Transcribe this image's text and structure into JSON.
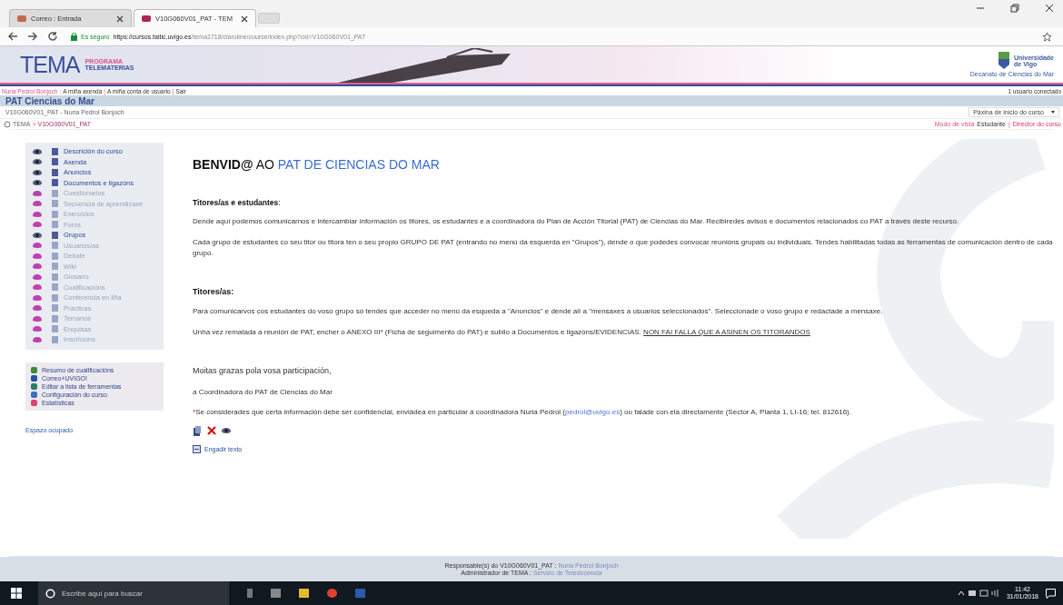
{
  "browser": {
    "tabs": [
      {
        "label": "Correo : Entrada",
        "selected": false
      },
      {
        "label": "V10G060V01_PAT - TEM",
        "selected": true
      }
    ],
    "security": "Es seguro",
    "url_host": "https://cursos.faitic.uvigo.es",
    "url_path": "/tema1718/claroline/course/index.php?cid=V10G060V01_PAT"
  },
  "banner": {
    "logo": "TEMA",
    "logo_sub1": "PROGRAMA",
    "logo_sub2": "TELEMATERIAS",
    "university1": "Universidade",
    "university2": "de Vigo",
    "faculty": "Decanato de Ciencias do Mar"
  },
  "user_bar": {
    "user": "Nuria Pedrol Bonjoch",
    "user_separator": ":",
    "link_separator": "|",
    "links": [
      "A miña axenda",
      "A miña conta de usuario",
      "Sair"
    ],
    "online": "1 usuario conectado"
  },
  "course": {
    "title": "PAT Ciencias do Mar",
    "subtitle": "V10G060V01_PAT - Nuria Pedrol Bonjoch",
    "home_select": "Páxina de inicio do curso"
  },
  "breadcrumb": {
    "root": "TEMA",
    "separator": ">",
    "view_separator": "|",
    "current": "V10G060V01_PAT",
    "view_label": "Modo de vista",
    "view_modes": [
      {
        "label": "Estudante",
        "selected": true
      },
      {
        "label": "Director do curso",
        "selected": false
      }
    ]
  },
  "tools": [
    {
      "label": "Descrición do curso",
      "visible": true
    },
    {
      "label": "Axenda",
      "visible": true
    },
    {
      "label": "Anuncios",
      "visible": true
    },
    {
      "label": "Documentos e ligazóns",
      "visible": true
    },
    {
      "label": "Cuestionarios",
      "visible": false
    },
    {
      "label": "Secuencia de aprendizaxe",
      "visible": false
    },
    {
      "label": "Exercicios",
      "visible": false
    },
    {
      "label": "Foros",
      "visible": false
    },
    {
      "label": "Grupos",
      "visible": true
    },
    {
      "label": "Usuarios/as",
      "visible": false
    },
    {
      "label": "Debate",
      "visible": false
    },
    {
      "label": "Wiki",
      "visible": false
    },
    {
      "label": "Glosario",
      "visible": false
    },
    {
      "label": "Cualificacións",
      "visible": false
    },
    {
      "label": "Conferencia en liña",
      "visible": false
    },
    {
      "label": "Prácticas",
      "visible": false
    },
    {
      "label": "Temarios",
      "visible": false
    },
    {
      "label": "Enquisas",
      "visible": false
    },
    {
      "label": "Inscricións",
      "visible": false
    }
  ],
  "admin_links": [
    "Resumo de cualificacións",
    "Correo+UVIGO!",
    "Editar a lista de ferramentas",
    "Configuración do curso",
    "Estatísticas"
  ],
  "disk_space": "Espazo ocupado",
  "content": {
    "heading_bold": "BENVID@",
    "heading_ao": "AO",
    "heading_link": "PAT DE CIENCIAS DO MAR",
    "section1": "Titores/as e estudantes",
    "section1_colon": ":",
    "p1": "Dende aquí podemos comunicarnos e intercambiar información os titores, os estudantes e a coordinadora do Plan de Acción Titorial (PAT) de Ciencias do Mar. Recibiredes avisos e documentos relacionados co PAT a través deste recurso.",
    "p2": "Cada grupo de estudantes co seu titor ou titora ten o seu propio GRUPO DE PAT (entrando no menú da esquerda en \"Grupos\"), dende o que podedes convocar reunións grupais ou individuais. Tendes habilitadas todas as ferramentas de comunicación dentro de cada grupo.",
    "section2": "Titores/as:",
    "p3": "Para comunicarvos cos estudantes do voso grupo só tendes que acceder no menú da esqueda a \"Anuncios\" e dende alí a \"mensaxes a usuarios seleccionados\". Seleccionade o voso grupo e redactade a mensaxe.",
    "p4": "Unha vez rematada a reunión de PAT, encher o ANEXO III* (Ficha de seguimento do PAT) e subilo a Documentos e ligazóns/EVIDENCIAS.",
    "p4_underlined": "NON FAI FALLA QUE A ASINEN OS TITORANDOS",
    "thanks": "Moitas grazas pola vosa participación,",
    "signature": "a Coordinadora do PAT de Ciencias do Mar",
    "note_star": "*",
    "note": "Se considerades que certa información debe ser confidencial, enviádea en particular á coordinadora Nuria Pedrol (",
    "note_email": "pedrol@uvigo.es",
    "note_end": ") ou falade con ela directamente (Sector A, Planta 1, LI-16; tel. 812616).",
    "add_text": "Engadir texto"
  },
  "footer": {
    "line1_label": "Responsable(s) do V10G060V01_PAT :",
    "line1_value": "Nuria Pedrol Bonjoch",
    "line2_label": "Administrador de TEMA :",
    "line2_value": "Servizo de Teledocencia"
  },
  "taskbar": {
    "search_placeholder": "Escribe aquí para buscar",
    "time": "11:42",
    "date": "31/01/2018"
  }
}
